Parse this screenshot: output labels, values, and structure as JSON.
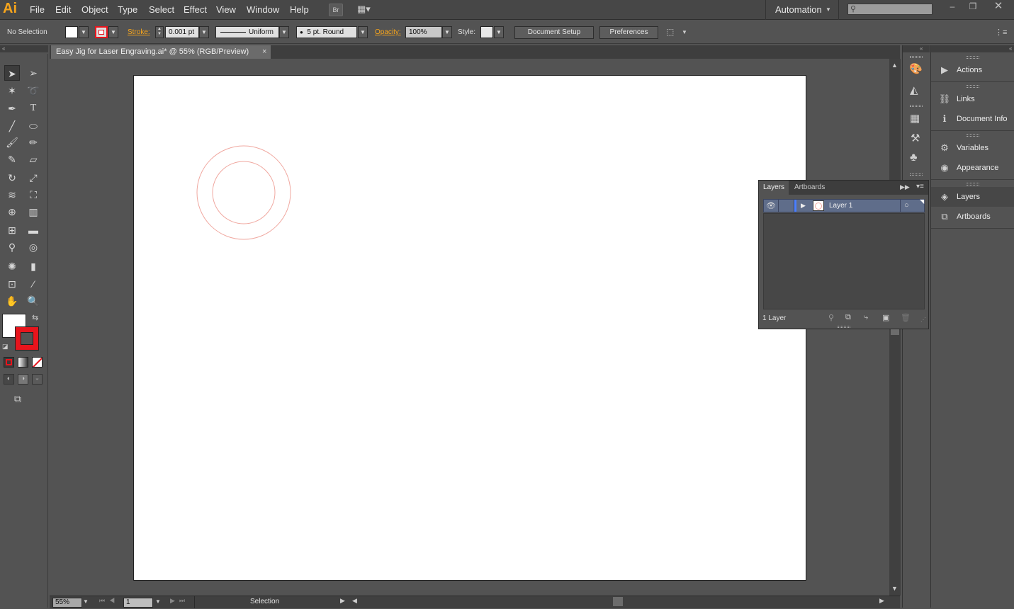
{
  "app": {
    "logo": "Ai"
  },
  "menubar": {
    "items": [
      "File",
      "Edit",
      "Object",
      "Type",
      "Select",
      "Effect",
      "View",
      "Window",
      "Help"
    ],
    "bridge_label": "Br",
    "workspace": "Automation"
  },
  "controlbar": {
    "selection_status": "No Selection",
    "stroke_label": "Stroke:",
    "stroke_weight": "0.001 pt",
    "profile": "Uniform",
    "brush": "5 pt. Round",
    "opacity_label": "Opacity:",
    "opacity": "100%",
    "style_label": "Style:",
    "document_setup": "Document Setup",
    "preferences": "Preferences",
    "stroke_color": "#e8141c",
    "fill_color": "#ffffff"
  },
  "document": {
    "tab_title": "Easy Jig for Laser Engraving.ai* @ 55% (RGB/Preview)",
    "close_glyph": "×",
    "circle_stroke_color": "#f0a8a0"
  },
  "layers_panel": {
    "tabs": [
      "Layers",
      "Artboards"
    ],
    "layer_name": "Layer 1",
    "count_text": "1 Layer"
  },
  "dock": {
    "items": [
      "Actions",
      "Links",
      "Document Info",
      "Variables",
      "Appearance",
      "Layers",
      "Artboards"
    ]
  },
  "statusbar": {
    "zoom": "55%",
    "artboard_number": "1",
    "tool": "Selection"
  }
}
